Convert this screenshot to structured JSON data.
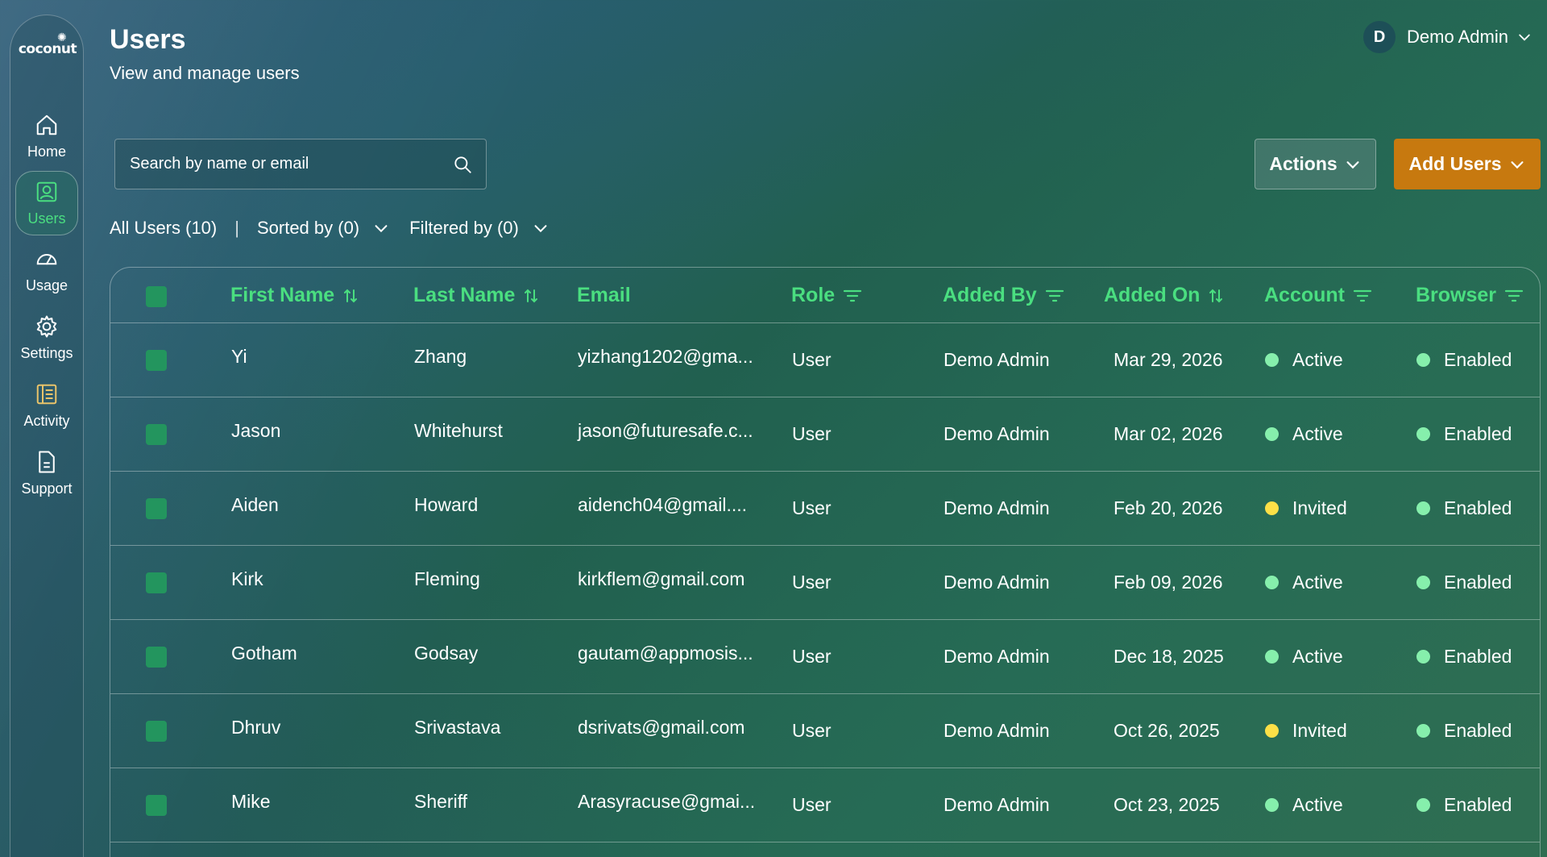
{
  "app": {
    "logo_text": "coconut",
    "title": "Users",
    "subtitle": "View and manage users"
  },
  "user_menu": {
    "avatar_initial": "D",
    "name": "Demo Admin"
  },
  "sidebar": {
    "items": [
      {
        "label": "Home",
        "icon": "home-icon",
        "active": false
      },
      {
        "label": "Users",
        "icon": "user-icon",
        "active": true
      },
      {
        "label": "Usage",
        "icon": "gauge-icon",
        "active": false
      },
      {
        "label": "Settings",
        "icon": "gear-icon",
        "active": false
      },
      {
        "label": "Activity",
        "icon": "activity-icon",
        "active": false
      },
      {
        "label": "Support",
        "icon": "document-icon",
        "active": false
      }
    ]
  },
  "search": {
    "placeholder": "Search by name or email",
    "value": ""
  },
  "toolbar": {
    "actions_label": "Actions",
    "add_users_label": "Add Users"
  },
  "filter_bar": {
    "all_users": "All Users (10)",
    "separator": "|",
    "sorted_by": "Sorted by (0)",
    "filtered_by": "Filtered by (0)"
  },
  "table": {
    "columns": [
      "First Name",
      "Last Name",
      "Email",
      "Role",
      "Added By",
      "Added On",
      "Account",
      "Browser"
    ],
    "rows": [
      {
        "first": "Yi",
        "last": "Zhang",
        "email": "yizhang1202@gma...",
        "role": "User",
        "added_by": "Demo Admin",
        "added_on": "Mar 29, 2026",
        "account": "Active",
        "browser": "Enabled"
      },
      {
        "first": "Jason",
        "last": "Whitehurst",
        "email": "jason@futuresafe.c...",
        "role": "User",
        "added_by": "Demo Admin",
        "added_on": "Mar 02, 2026",
        "account": "Active",
        "browser": "Enabled"
      },
      {
        "first": "Aiden",
        "last": "Howard",
        "email": "aidench04@gmail....",
        "role": "User",
        "added_by": "Demo Admin",
        "added_on": "Feb 20, 2026",
        "account": "Invited",
        "browser": "Enabled"
      },
      {
        "first": "Kirk",
        "last": "Fleming",
        "email": "kirkflem@gmail.com",
        "role": "User",
        "added_by": "Demo Admin",
        "added_on": "Feb 09, 2026",
        "account": "Active",
        "browser": "Enabled"
      },
      {
        "first": "Gotham",
        "last": "Godsay",
        "email": "gautam@appmosis...",
        "role": "User",
        "added_by": "Demo Admin",
        "added_on": "Dec 18, 2025",
        "account": "Active",
        "browser": "Enabled"
      },
      {
        "first": "Dhruv",
        "last": "Srivastava",
        "email": "dsrivats@gmail.com",
        "role": "User",
        "added_by": "Demo Admin",
        "added_on": "Oct 26, 2025",
        "account": "Invited",
        "browser": "Enabled"
      },
      {
        "first": "Mike",
        "last": "Sheriff",
        "email": "Arasyracuse@gmai...",
        "role": "User",
        "added_by": "Demo Admin",
        "added_on": "Oct 23, 2025",
        "account": "Active",
        "browser": "Enabled"
      }
    ]
  },
  "colors": {
    "accent_green": "#4ade80",
    "checkbox_green": "#23955e",
    "add_button": "#c7790f",
    "status_active": "#86efac",
    "status_invited": "#fde047"
  }
}
